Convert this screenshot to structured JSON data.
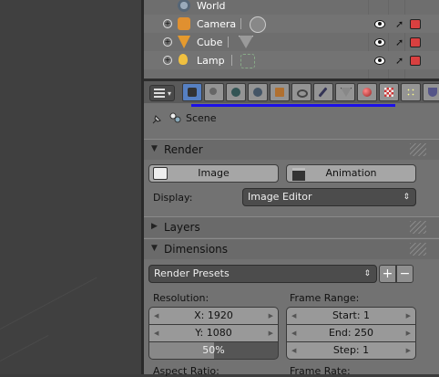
{
  "outliner": {
    "rows": [
      {
        "label": "World",
        "icon": "world-icon"
      },
      {
        "label": "Camera",
        "icon": "camera-object-icon"
      },
      {
        "label": "Cube",
        "icon": "mesh-object-icon"
      },
      {
        "label": "Lamp",
        "icon": "lamp-object-icon"
      }
    ]
  },
  "context": {
    "scene_label": "Scene"
  },
  "render": {
    "title": "Render",
    "image_button": "Image",
    "animation_button": "Animation",
    "display_label": "Display:",
    "display_value": "Image Editor"
  },
  "layers": {
    "title": "Layers"
  },
  "dimensions": {
    "title": "Dimensions",
    "presets_value": "Render Presets",
    "add_symbol": "+",
    "remove_symbol": "−",
    "resolution_label": "Resolution:",
    "res_x": "X: 1920",
    "res_y": "Y: 1080",
    "res_percent": "50%",
    "frame_range_label": "Frame Range:",
    "start": "Start: 1",
    "end": "End: 250",
    "step": "Step: 1",
    "aspect_label": "Aspect Ratio:",
    "frame_rate_label": "Frame Rate:"
  },
  "colors": {
    "active_tab": "#5680c2",
    "highlight_line": "#1b10e8"
  }
}
